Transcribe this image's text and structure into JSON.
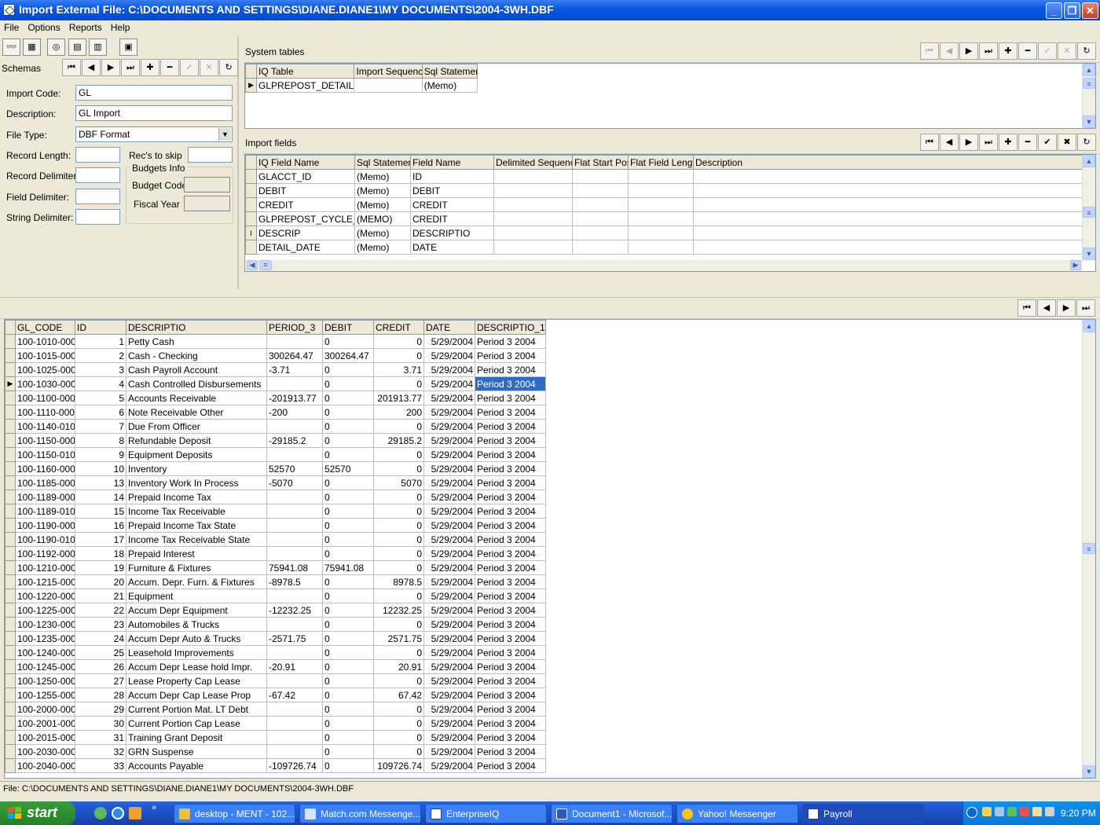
{
  "window": {
    "title": "Import External File: C:\\DOCUMENTS AND SETTINGS\\DIANE.DIANE1\\MY DOCUMENTS\\2004-3WH.DBF"
  },
  "menu": [
    "File",
    "Options",
    "Reports",
    "Help"
  ],
  "schemas": {
    "label": "Schemas"
  },
  "form": {
    "import_code_label": "Import Code:",
    "import_code": "GL",
    "description_label": "Description:",
    "description": "GL Import",
    "file_type_label": "File Type:",
    "file_type": "DBF Format",
    "record_length_label": "Record Length:",
    "recs_to_skip_label": "Rec's to skip",
    "record_delimiters_label": "Record Delimiters:",
    "field_delimiter_label": "Field Delimiter:",
    "string_delimiter_label": "String Delimiter:",
    "budgets_info_label": "Budgets Info",
    "budget_code_label": "Budget Code",
    "fiscal_year_label": "Fiscal Year"
  },
  "system_tables": {
    "label": "System tables",
    "columns": [
      "IQ Table",
      "Import Sequence",
      "Sql Statement"
    ],
    "rows": [
      [
        "GLPREPOST_DETAIL",
        "",
        "(Memo)"
      ]
    ]
  },
  "import_fields": {
    "label": "Import fields",
    "columns": [
      "IQ Field Name",
      "Sql Statement",
      "Field Name",
      "Delimited Sequence",
      "Flat Start Pos.",
      "Flat Field Length",
      "Description"
    ],
    "rows": [
      [
        "GLACCT_ID",
        "(Memo)",
        "ID",
        "",
        "",
        "",
        ""
      ],
      [
        "DEBIT",
        "(Memo)",
        "DEBIT",
        "",
        "",
        "",
        ""
      ],
      [
        "CREDIT",
        "(Memo)",
        "CREDIT",
        "",
        "",
        "",
        ""
      ],
      [
        "GLPREPOST_CYCLE_ID",
        "(MEMO)",
        "CREDIT",
        "",
        "",
        "",
        ""
      ],
      [
        "DESCRIP",
        "(Memo)",
        "DESCRIPTIO",
        "",
        "",
        "",
        ""
      ],
      [
        "DETAIL_DATE",
        "(Memo)",
        "DATE",
        "",
        "",
        "",
        ""
      ]
    ]
  },
  "data_grid": {
    "columns": [
      "GL_CODE",
      "ID",
      "DESCRIPTIO",
      "PERIOD_3",
      "DEBIT",
      "CREDIT",
      "DATE",
      "DESCRIPTIO_1"
    ],
    "rows": [
      [
        "100-1010-000",
        "1",
        "Petty Cash",
        "",
        "0",
        "0",
        "5/29/2004",
        "Period 3 2004"
      ],
      [
        "100-1015-000",
        "2",
        "Cash - Checking",
        "300264.47",
        "300264.47",
        "0",
        "5/29/2004",
        "Period 3 2004"
      ],
      [
        "100-1025-000",
        "3",
        "Cash Payroll Account",
        "-3.71",
        "0",
        "3.71",
        "5/29/2004",
        "Period 3 2004"
      ],
      [
        "100-1030-000",
        "4",
        "Cash Controlled Disbursements",
        "",
        "0",
        "0",
        "5/29/2004",
        "Period 3 2004"
      ],
      [
        "100-1100-000",
        "5",
        "Accounts Receivable",
        "-201913.77",
        "0",
        "201913.77",
        "5/29/2004",
        "Period 3 2004"
      ],
      [
        "100-1110-000",
        "6",
        "Note Receivable Other",
        "-200",
        "0",
        "200",
        "5/29/2004",
        "Period 3 2004"
      ],
      [
        "100-1140-010",
        "7",
        "Due From Officer",
        "",
        "0",
        "0",
        "5/29/2004",
        "Period 3 2004"
      ],
      [
        "100-1150-000",
        "8",
        "Refundable Deposit",
        "-29185.2",
        "0",
        "29185.2",
        "5/29/2004",
        "Period 3 2004"
      ],
      [
        "100-1150-010",
        "9",
        "Equipment Deposits",
        "",
        "0",
        "0",
        "5/29/2004",
        "Period 3 2004"
      ],
      [
        "100-1160-000",
        "10",
        "Inventory",
        "52570",
        "52570",
        "0",
        "5/29/2004",
        "Period 3 2004"
      ],
      [
        "100-1185-000",
        "13",
        "Inventory Work In Process",
        "-5070",
        "0",
        "5070",
        "5/29/2004",
        "Period 3 2004"
      ],
      [
        "100-1189-000",
        "14",
        "Prepaid Income Tax",
        "",
        "0",
        "0",
        "5/29/2004",
        "Period 3 2004"
      ],
      [
        "100-1189-010",
        "15",
        "Income Tax Receivable",
        "",
        "0",
        "0",
        "5/29/2004",
        "Period 3 2004"
      ],
      [
        "100-1190-000",
        "16",
        "Prepaid Income Tax State",
        "",
        "0",
        "0",
        "5/29/2004",
        "Period 3 2004"
      ],
      [
        "100-1190-010",
        "17",
        "Income Tax Receivable State",
        "",
        "0",
        "0",
        "5/29/2004",
        "Period 3 2004"
      ],
      [
        "100-1192-000",
        "18",
        "Prepaid Interest",
        "",
        "0",
        "0",
        "5/29/2004",
        "Period 3 2004"
      ],
      [
        "100-1210-000",
        "19",
        "Furniture & Fixtures",
        "75941.08",
        "75941.08",
        "0",
        "5/29/2004",
        "Period 3 2004"
      ],
      [
        "100-1215-000",
        "20",
        "Accum. Depr. Furn. & Fixtures",
        "-8978.5",
        "0",
        "8978.5",
        "5/29/2004",
        "Period 3 2004"
      ],
      [
        "100-1220-000",
        "21",
        "Equipment",
        "",
        "0",
        "0",
        "5/29/2004",
        "Period 3 2004"
      ],
      [
        "100-1225-000",
        "22",
        "Accum Depr Equipment",
        "-12232.25",
        "0",
        "12232.25",
        "5/29/2004",
        "Period 3 2004"
      ],
      [
        "100-1230-000",
        "23",
        "Automobiles & Trucks",
        "",
        "0",
        "0",
        "5/29/2004",
        "Period 3 2004"
      ],
      [
        "100-1235-000",
        "24",
        "Accum Depr Auto & Trucks",
        "-2571.75",
        "0",
        "2571.75",
        "5/29/2004",
        "Period 3 2004"
      ],
      [
        "100-1240-000",
        "25",
        "Leasehold Improvements",
        "",
        "0",
        "0",
        "5/29/2004",
        "Period 3 2004"
      ],
      [
        "100-1245-000",
        "26",
        "Accum Depr Lease hold Impr.",
        "-20.91",
        "0",
        "20.91",
        "5/29/2004",
        "Period 3 2004"
      ],
      [
        "100-1250-000",
        "27",
        "Lease Property Cap Lease",
        "",
        "0",
        "0",
        "5/29/2004",
        "Period 3 2004"
      ],
      [
        "100-1255-000",
        "28",
        "Accum Depr Cap Lease Prop",
        "-67.42",
        "0",
        "67.42",
        "5/29/2004",
        "Period 3 2004"
      ],
      [
        "100-2000-000",
        "29",
        "Current Portion Mat. LT Debt",
        "",
        "0",
        "0",
        "5/29/2004",
        "Period 3 2004"
      ],
      [
        "100-2001-000",
        "30",
        "Current Portion Cap Lease",
        "",
        "0",
        "0",
        "5/29/2004",
        "Period 3 2004"
      ],
      [
        "100-2015-000",
        "31",
        "Training Grant Deposit",
        "",
        "0",
        "0",
        "5/29/2004",
        "Period 3 2004"
      ],
      [
        "100-2030-000",
        "32",
        "GRN Suspense",
        "",
        "0",
        "0",
        "5/29/2004",
        "Period 3 2004"
      ],
      [
        "100-2040-000",
        "33",
        "Accounts Payable",
        "-109726.74",
        "0",
        "109726.74",
        "5/29/2004",
        "Period 3 2004"
      ]
    ]
  },
  "status": {
    "text": "File: C:\\DOCUMENTS AND SETTINGS\\DIANE.DIANE1\\MY DOCUMENTS\\2004-3WH.DBF"
  },
  "taskbar": {
    "start": "start",
    "tasks": [
      "desktop - MENT - 102...",
      "Match.com Messenge...",
      "EnterpriseIQ",
      "Document1 - Microsof...",
      "Yahoo! Messenger",
      "Payroll"
    ],
    "clock": "9:20 PM"
  }
}
